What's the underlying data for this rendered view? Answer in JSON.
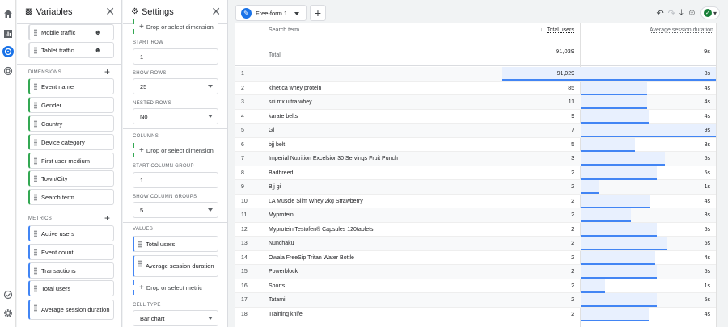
{
  "variables_panel": {
    "title": "Variables",
    "segments": [
      {
        "label": "Mobile traffic"
      },
      {
        "label": "Tablet traffic"
      }
    ],
    "dimensions_label": "DIMENSIONS",
    "dimensions": [
      "Event name",
      "Gender",
      "Country",
      "Device category",
      "First user medium",
      "Town/City",
      "Search term"
    ],
    "metrics_label": "METRICS",
    "metrics": [
      "Active users",
      "Event count",
      "Transactions",
      "Total users",
      "Average session duration"
    ]
  },
  "settings_panel": {
    "title": "Settings",
    "drop_row_dimension": "Drop or select dimension",
    "start_row_label": "START ROW",
    "start_row_value": "1",
    "show_rows_label": "SHOW ROWS",
    "show_rows_value": "25",
    "nested_rows_label": "NESTED ROWS",
    "nested_rows_value": "No",
    "columns_label": "COLUMNS",
    "drop_col_dimension": "Drop or select dimension",
    "start_col_group_label": "START COLUMN GROUP",
    "start_col_group_value": "1",
    "show_col_groups_label": "SHOW COLUMN GROUPS",
    "show_col_groups_value": "5",
    "values_label": "VALUES",
    "values": [
      "Total users",
      "Average session duration"
    ],
    "drop_metric": "Drop or select metric",
    "cell_type_label": "CELL TYPE",
    "cell_type_value": "Bar chart"
  },
  "main": {
    "tab_label": "Free-form 1",
    "table": {
      "col_term": "Search term",
      "col_users": "Total users",
      "col_duration": "Average session duration",
      "total_label": "Total",
      "total_users": "91,039",
      "total_duration": "9s",
      "rows": [
        {
          "i": "1",
          "term": "",
          "users": "91,029",
          "ufrac": 1.0,
          "dur": "8s",
          "dfrac": 1.0
        },
        {
          "i": "2",
          "term": "kinetica whey protein",
          "users": "85",
          "ufrac": 0,
          "dur": "4s",
          "dfrac": 0.49
        },
        {
          "i": "3",
          "term": "sci mx ultra whey",
          "users": "11",
          "ufrac": 0,
          "dur": "4s",
          "dfrac": 0.49
        },
        {
          "i": "4",
          "term": "karate belts",
          "users": "9",
          "ufrac": 0,
          "dur": "4s",
          "dfrac": 0.5
        },
        {
          "i": "5",
          "term": "Gi",
          "users": "7",
          "ufrac": 0,
          "dur": "9s",
          "dfrac": 1.0
        },
        {
          "i": "6",
          "term": "bjj belt",
          "users": "5",
          "ufrac": 0,
          "dur": "3s",
          "dfrac": 0.4
        },
        {
          "i": "7",
          "term": "Imperial Nutrition Excelsior 30 Servings Fruit Punch",
          "users": "3",
          "ufrac": 0,
          "dur": "5s",
          "dfrac": 0.62
        },
        {
          "i": "8",
          "term": "Badbreed",
          "users": "2",
          "ufrac": 0,
          "dur": "5s",
          "dfrac": 0.56
        },
        {
          "i": "9",
          "term": "Bjj gi",
          "users": "2",
          "ufrac": 0,
          "dur": "1s",
          "dfrac": 0.13
        },
        {
          "i": "10",
          "term": "LA Muscle Slim Whey 2kg Strawberry",
          "users": "2",
          "ufrac": 0,
          "dur": "4s",
          "dfrac": 0.51
        },
        {
          "i": "11",
          "term": "Myprotein",
          "users": "2",
          "ufrac": 0,
          "dur": "3s",
          "dfrac": 0.37
        },
        {
          "i": "12",
          "term": "Myprotein Testofen® Capsules 120tablets",
          "users": "2",
          "ufrac": 0,
          "dur": "5s",
          "dfrac": 0.56
        },
        {
          "i": "13",
          "term": "Nunchaku",
          "users": "2",
          "ufrac": 0,
          "dur": "5s",
          "dfrac": 0.64
        },
        {
          "i": "14",
          "term": "Owala FreeSip Tritan Water Bottle",
          "users": "2",
          "ufrac": 0,
          "dur": "4s",
          "dfrac": 0.55
        },
        {
          "i": "15",
          "term": "Powerblock",
          "users": "2",
          "ufrac": 0,
          "dur": "5s",
          "dfrac": 0.56
        },
        {
          "i": "16",
          "term": "Shorts",
          "users": "2",
          "ufrac": 0,
          "dur": "1s",
          "dfrac": 0.18
        },
        {
          "i": "17",
          "term": "Tatami",
          "users": "2",
          "ufrac": 0,
          "dur": "5s",
          "dfrac": 0.56
        },
        {
          "i": "18",
          "term": "Training knife",
          "users": "2",
          "ufrac": 0,
          "dur": "4s",
          "dfrac": 0.5
        }
      ]
    }
  },
  "colors": {
    "accent": "#1a73e8",
    "dimension": "#34a853",
    "metric": "#4285f4",
    "bar_fill": "#e8f0fe"
  }
}
